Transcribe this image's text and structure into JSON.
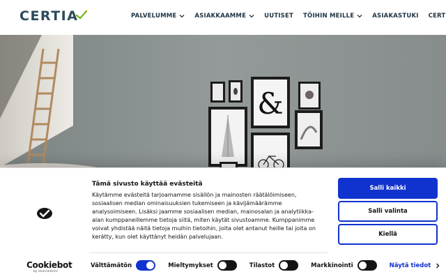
{
  "header": {
    "logo_text": "CERTIA",
    "nav": [
      {
        "label": "PALVELUMME",
        "has_dropdown": true
      },
      {
        "label": "ASIAKKAAMME",
        "has_dropdown": true
      },
      {
        "label": "UUTISET",
        "has_dropdown": false
      },
      {
        "label": "TÖIHIN MEILLE",
        "has_dropdown": true
      },
      {
        "label": "ASIAKASTUKI",
        "has_dropdown": false
      },
      {
        "label": "CERTIA",
        "has_dropdown": true
      }
    ]
  },
  "hero": {
    "wall_frames_icons": [
      "ampersand-print",
      "building-print",
      "bicycle-print",
      "leaf-print",
      "flower-print"
    ]
  },
  "cookie_banner": {
    "brand": "Cookiebot",
    "brand_sub": "by Usercentrics",
    "title": "Tämä sivusto käyttää evästeitä",
    "body": "Käytämme evästeitä tarjoamamme sisällön ja mainosten räätälöimiseen, sosiaalisen median ominaisuuksien tukemiseen ja kävijämäärämme analysoimiseen. Lisäksi jaamme sosiaalisen median, mainosalan ja analytiikka-alan kumppaneillemme tietoja siitä, miten käytät sivustoamme. Kumppanimme voivat yhdistää näitä tietoja muihin tietoihin, joita olet antanut heille tai joita on kerätty, kun olet käyttänyt heidän palvelujaan.",
    "toggles": [
      {
        "label": "Välttämätön",
        "checked": true
      },
      {
        "label": "Mieltymykset",
        "checked": false
      },
      {
        "label": "Tilastot",
        "checked": false
      },
      {
        "label": "Markkinointi",
        "checked": false
      }
    ],
    "details_link": "Näytä tiedot",
    "buttons": {
      "allow_all": "Salli kaikki",
      "allow_selection": "Salli valinta",
      "deny": "Kiellä"
    },
    "colors": {
      "accent": "#1032cf",
      "logo_text": "#2c4a5e",
      "logo_mark": "#7ab51d"
    }
  }
}
